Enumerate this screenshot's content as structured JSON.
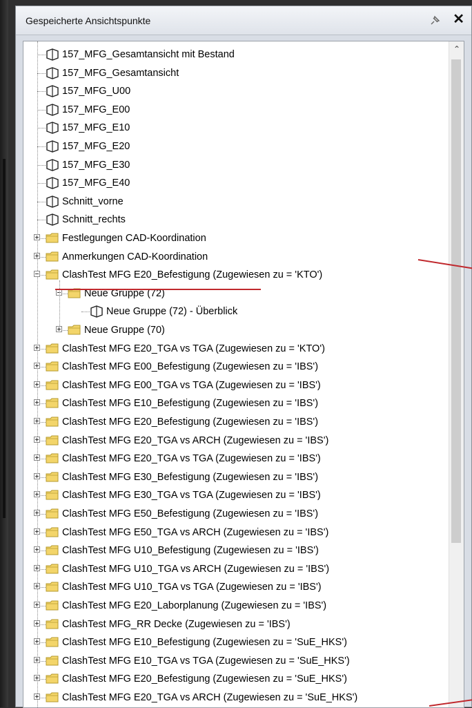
{
  "panel": {
    "title": "Gespeicherte Ansichtspunkte"
  },
  "tree": {
    "items": [
      {
        "label": "157_MFG_Gesamtansicht mit Bestand",
        "type": "view",
        "level": 0
      },
      {
        "label": "157_MFG_Gesamtansicht",
        "type": "view",
        "level": 0
      },
      {
        "label": "157_MFG_U00",
        "type": "view",
        "level": 0
      },
      {
        "label": "157_MFG_E00",
        "type": "view",
        "level": 0
      },
      {
        "label": "157_MFG_E10",
        "type": "view",
        "level": 0
      },
      {
        "label": "157_MFG_E20",
        "type": "view",
        "level": 0
      },
      {
        "label": "157_MFG_E30",
        "type": "view",
        "level": 0
      },
      {
        "label": "157_MFG_E40",
        "type": "view",
        "level": 0
      },
      {
        "label": "Schnitt_vorne",
        "type": "view",
        "level": 0
      },
      {
        "label": "Schnitt_rechts",
        "type": "view",
        "level": 0
      },
      {
        "label": "Festlegungen CAD-Koordination",
        "type": "folder",
        "level": 0,
        "expanded": false
      },
      {
        "label": "Anmerkungen CAD-Koordination",
        "type": "folder",
        "level": 0,
        "expanded": false
      },
      {
        "label": "ClashTest MFG E20_Befestigung (Zugewiesen zu = 'KTO')",
        "type": "folder",
        "level": 0,
        "expanded": true
      },
      {
        "label": "Neue Gruppe (72)",
        "type": "folder",
        "level": 1,
        "expanded": true
      },
      {
        "label": "Neue Gruppe (72) - Überblick",
        "type": "view",
        "level": 2
      },
      {
        "label": "Neue Gruppe (70)",
        "type": "folder",
        "level": 1,
        "expanded": false
      },
      {
        "label": "ClashTest MFG E20_TGA vs TGA (Zugewiesen zu = 'KTO')",
        "type": "folder",
        "level": 0,
        "expanded": false
      },
      {
        "label": "ClashTest MFG E00_Befestigung (Zugewiesen zu = 'IBS')",
        "type": "folder",
        "level": 0,
        "expanded": false
      },
      {
        "label": "ClashTest MFG E00_TGA vs TGA (Zugewiesen zu = 'IBS')",
        "type": "folder",
        "level": 0,
        "expanded": false
      },
      {
        "label": "ClashTest MFG E10_Befestigung (Zugewiesen zu = 'IBS')",
        "type": "folder",
        "level": 0,
        "expanded": false
      },
      {
        "label": "ClashTest MFG E20_Befestigung (Zugewiesen zu = 'IBS')",
        "type": "folder",
        "level": 0,
        "expanded": false
      },
      {
        "label": "ClashTest MFG E20_TGA vs ARCH (Zugewiesen zu = 'IBS')",
        "type": "folder",
        "level": 0,
        "expanded": false
      },
      {
        "label": "ClashTest MFG E20_TGA vs TGA (Zugewiesen zu = 'IBS')",
        "type": "folder",
        "level": 0,
        "expanded": false
      },
      {
        "label": "ClashTest MFG E30_Befestigung (Zugewiesen zu = 'IBS')",
        "type": "folder",
        "level": 0,
        "expanded": false
      },
      {
        "label": "ClashTest MFG E30_TGA vs TGA (Zugewiesen zu = 'IBS')",
        "type": "folder",
        "level": 0,
        "expanded": false
      },
      {
        "label": "ClashTest MFG E50_Befestigung (Zugewiesen zu = 'IBS')",
        "type": "folder",
        "level": 0,
        "expanded": false
      },
      {
        "label": "ClashTest MFG E50_TGA vs ARCH (Zugewiesen zu = 'IBS')",
        "type": "folder",
        "level": 0,
        "expanded": false
      },
      {
        "label": "ClashTest MFG U10_Befestigung (Zugewiesen zu = 'IBS')",
        "type": "folder",
        "level": 0,
        "expanded": false
      },
      {
        "label": "ClashTest MFG U10_TGA vs ARCH (Zugewiesen zu = 'IBS')",
        "type": "folder",
        "level": 0,
        "expanded": false
      },
      {
        "label": "ClashTest MFG U10_TGA vs TGA (Zugewiesen zu = 'IBS')",
        "type": "folder",
        "level": 0,
        "expanded": false
      },
      {
        "label": "ClashTest MFG E20_Laborplanung (Zugewiesen zu = 'IBS')",
        "type": "folder",
        "level": 0,
        "expanded": false
      },
      {
        "label": "ClashTest MFG_RR Decke (Zugewiesen zu = 'IBS')",
        "type": "folder",
        "level": 0,
        "expanded": false
      },
      {
        "label": "ClashTest MFG E10_Befestigung (Zugewiesen zu = 'SuE_HKS')",
        "type": "folder",
        "level": 0,
        "expanded": false
      },
      {
        "label": "ClashTest MFG E10_TGA vs TGA (Zugewiesen zu = 'SuE_HKS')",
        "type": "folder",
        "level": 0,
        "expanded": false
      },
      {
        "label": "ClashTest MFG E20_Befestigung (Zugewiesen zu = 'SuE_HKS')",
        "type": "folder",
        "level": 0,
        "expanded": false
      },
      {
        "label": "ClashTest MFG E20_TGA vs ARCH (Zugewiesen zu = 'SuE_HKS')",
        "type": "folder",
        "level": 0,
        "expanded": false
      }
    ]
  },
  "colors": {
    "folder": "#f3d56a",
    "folder_border": "#b59a2f",
    "annotation": "#c0282d"
  },
  "icons": {
    "view": "viewpoint-camera-icon",
    "folder": "folder-icon",
    "pin": "pin-icon",
    "close": "close-icon"
  }
}
